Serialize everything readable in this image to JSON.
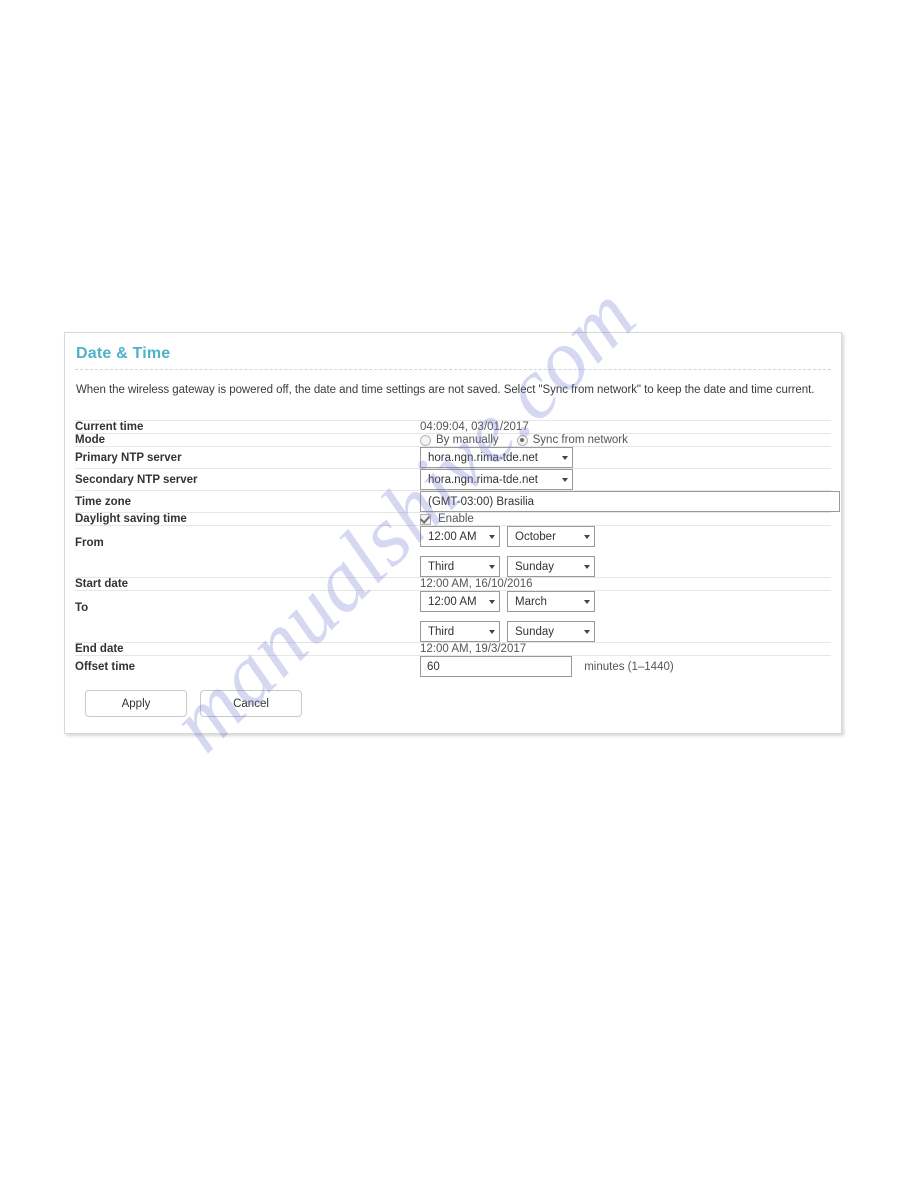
{
  "panel": {
    "title": "Date & Time",
    "description": "When the wireless gateway is powered off, the date and time settings are not saved. Select \"Sync from network\" to keep the date and time current.",
    "accent_color": "#4eb3c9"
  },
  "rows": {
    "current_time": {
      "label": "Current time",
      "value": "04:09:04, 03/01/2017"
    },
    "mode": {
      "label": "Mode",
      "options": [
        {
          "label": "By manually",
          "selected": false
        },
        {
          "label": "Sync from network",
          "selected": true
        }
      ]
    },
    "primary_ntp": {
      "label": "Primary NTP server",
      "value": "hora.ngn.rima-tde.net"
    },
    "secondary_ntp": {
      "label": "Secondary NTP server",
      "value": "hora.ngn.rima-tde.net"
    },
    "time_zone": {
      "label": "Time zone",
      "value": "(GMT-03:00) Brasilia"
    },
    "dst": {
      "label": "Daylight saving time",
      "enable_label": "Enable",
      "enabled": true
    },
    "from": {
      "label": "From",
      "time": "12:00 AM",
      "month": "October",
      "week": "Third",
      "day": "Sunday"
    },
    "start_date": {
      "label": "Start date",
      "value": "12:00 AM, 16/10/2016"
    },
    "to": {
      "label": "To",
      "time": "12:00 AM",
      "month": "March",
      "week": "Third",
      "day": "Sunday"
    },
    "end_date": {
      "label": "End date",
      "value": "12:00 AM, 19/3/2017"
    },
    "offset_time": {
      "label": "Offset time",
      "value": "60",
      "hint": "minutes (1–1440)"
    }
  },
  "footer": {
    "apply_label": "Apply",
    "cancel_label": "Cancel"
  },
  "watermark": {
    "text": "manualshive.com"
  }
}
